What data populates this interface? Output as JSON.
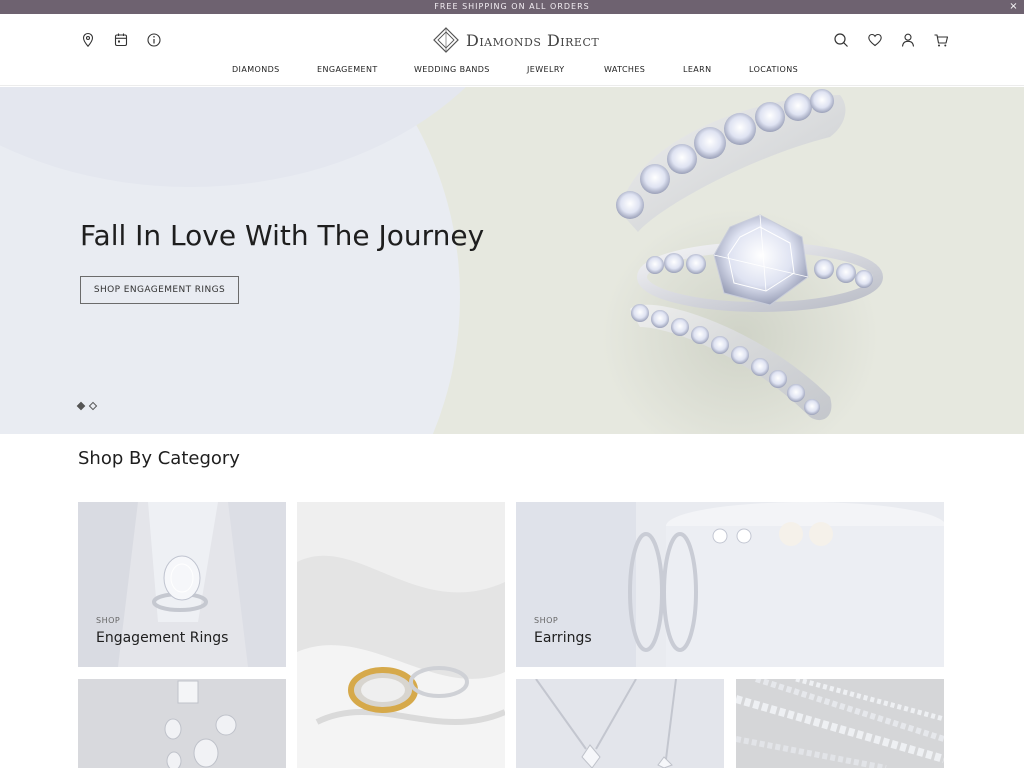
{
  "promo": {
    "text": "FREE SHIPPING ON ALL ORDERS",
    "close": "×"
  },
  "brand": {
    "name": "Diamonds Direct"
  },
  "nav": [
    "DIAMONDS",
    "ENGAGEMENT",
    "WEDDING BANDS",
    "JEWELRY",
    "WATCHES",
    "LEARN",
    "LOCATIONS"
  ],
  "hero": {
    "title": "Fall In Love With The Journey",
    "button": "SHOP ENGAGEMENT RINGS",
    "slides": 2,
    "active_slide": 1
  },
  "section": {
    "title": "Shop By Category"
  },
  "categories": [
    {
      "kicker": "SHOP",
      "label": "Engagement Rings"
    },
    {
      "kicker": "SHOP",
      "label": "Earrings"
    }
  ],
  "icons": {
    "left": [
      "location-pin-icon",
      "calendar-icon",
      "info-icon"
    ],
    "right": [
      "search-icon",
      "heart-icon",
      "account-icon",
      "cart-icon"
    ]
  },
  "colors": {
    "promo_bar": "#6e6270",
    "hero_bg": "#e6e8df"
  }
}
